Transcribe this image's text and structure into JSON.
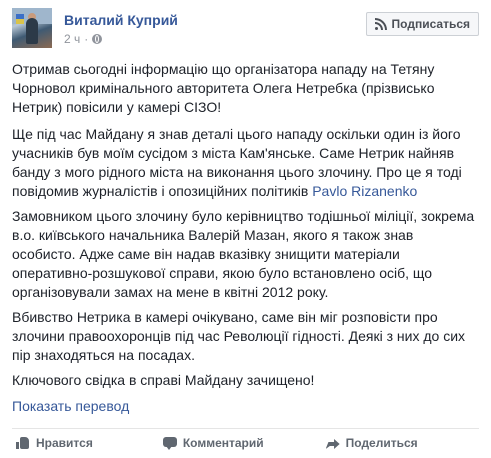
{
  "header": {
    "author_name": "Виталий Куприй",
    "time": "2 ч",
    "visibility_icon": "globe-icon",
    "subscribe_label": "Подписаться",
    "subscribe_icon": "rss-icon"
  },
  "post": {
    "p1": "Отримав сьогодні інформацію що організатора нападу на Тетяну Чорновол кримінального авторитета Олега Нетребка (прізвисько Нетрик) повісили у камері СІЗО!",
    "p2_text": "Ще під час Майдану я знав деталі цього нападу оскільки один із його учасників був моїм сусідом з міста Кам'янське. Саме Нетрик найняв банду з мого рідного міста на виконання цього злочину. Про це я тоді повідомив журналістів і опозиційних політиків ",
    "p2_link": "Pavlo Rizanenko",
    "p3": "Замовником цього злочину було керівництво тодішньої міліції, зокрема в.о. київського начальника Валерій Мазан, якого я також знав особисто. Адже саме він надав вказівку знищити матеріали оперативно-розшукової справи, якою було встановлено осіб, що організовували замах на мене в квітні 2012 року.",
    "p4": "Вбивство Нетрика в камері очікувано, саме він міг розповісти про злочини правоохоронців під час Революції гідності. Деякі з них до сих пір знаходяться на посадах.",
    "p5": "Ключового свідка в справі Майдану зачищено!",
    "translate_label": "Показать перевод"
  },
  "actions": {
    "like_label": "Нравится",
    "comment_label": "Комментарий",
    "share_label": "Поделиться"
  },
  "colors": {
    "link": "#365899",
    "text": "#1d2129",
    "muted": "#90949c"
  }
}
